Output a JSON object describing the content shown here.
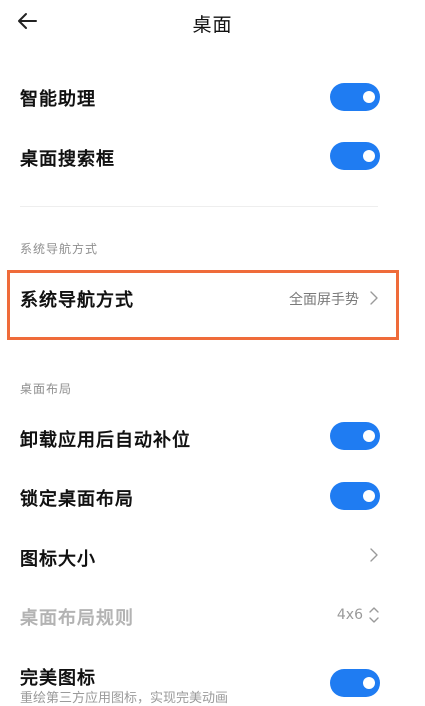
{
  "header": {
    "title": "桌面",
    "back_icon": "arrow-left-icon"
  },
  "settings": {
    "assistant": {
      "label": "智能助理",
      "enabled": true
    },
    "search_bar": {
      "label": "桌面搜索框",
      "enabled": true
    },
    "nav_section": {
      "title": "系统导航方式"
    },
    "nav_mode": {
      "label": "系统导航方式",
      "value": "全面屏手势"
    },
    "layout_section": {
      "title": "桌面布局"
    },
    "auto_fill": {
      "label": "卸载应用后自动补位",
      "enabled": true
    },
    "lock_layout": {
      "label": "锁定桌面布局",
      "enabled": true
    },
    "icon_size": {
      "label": "图标大小"
    },
    "layout_rule": {
      "label": "桌面布局规则",
      "value": "4x6"
    },
    "perfect_icons": {
      "label": "完美图标",
      "description": "重绘第三方应用图标，实现完美动画",
      "enabled": true
    }
  },
  "colors": {
    "toggle_on": "#1f7cf2",
    "highlight": "#ef6b3a"
  }
}
